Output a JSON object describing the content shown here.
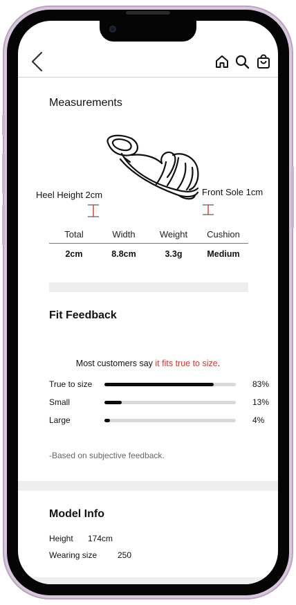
{
  "header": {
    "back_icon": "chevron-left-icon",
    "icons": [
      "home-icon",
      "search-icon",
      "shopping-bag-icon"
    ]
  },
  "measurements": {
    "title": "Measurements",
    "heel_label": "Heel Height 2cm",
    "sole_label": "Front Sole 1cm",
    "marker_color": "#e0302a",
    "columns": [
      "Total",
      "Width",
      "Weight",
      "Cushion"
    ],
    "values": [
      "2cm",
      "8.8cm",
      "3.3g",
      "Medium"
    ]
  },
  "fit": {
    "title": "Fit Feedback",
    "summary_prefix": "Most customers say ",
    "summary_highlight": "it fits true to size",
    "summary_suffix": ".",
    "highlight_color": "#e0302a",
    "rows": [
      {
        "label": "True to size",
        "percent": "83%",
        "fraction": 0.83
      },
      {
        "label": "Small",
        "percent": "13%",
        "fraction": 0.13
      },
      {
        "label": "Large",
        "percent": "4%",
        "fraction": 0.04
      }
    ],
    "note": "-Based on subjective feedback."
  },
  "model": {
    "title": "Model Info",
    "height_label": "Height",
    "height_value": "174cm",
    "size_label": "Wearing size",
    "size_value": "250"
  },
  "colors": {
    "frame": "#d9c7dd",
    "section_divider": "#eceef0"
  }
}
